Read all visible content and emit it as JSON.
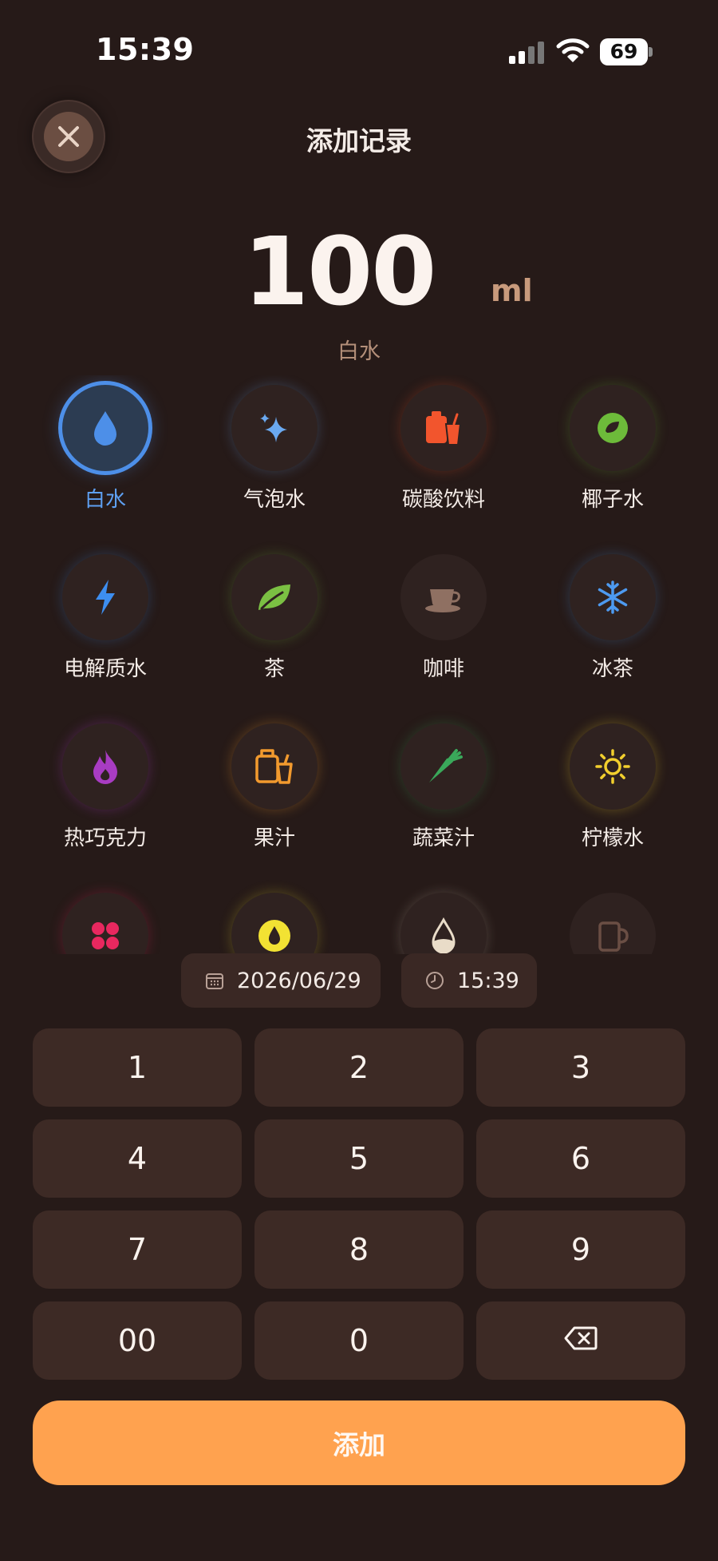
{
  "status_bar": {
    "time": "15:39",
    "battery": "69"
  },
  "header": {
    "title": "添加记录"
  },
  "amount": {
    "value": "100",
    "unit": "ml",
    "drink": "白水"
  },
  "drinks": [
    {
      "label": "白水",
      "icon": "water-drop-icon",
      "color": "#4d8fe8",
      "selected": true
    },
    {
      "label": "气泡水",
      "icon": "sparkles-icon",
      "color": "#6aa9f0"
    },
    {
      "label": "碳酸饮料",
      "icon": "soda-can-icon",
      "color": "#f2552d"
    },
    {
      "label": "椰子水",
      "icon": "coconut-icon",
      "color": "#6dbb3a"
    },
    {
      "label": "电解质水",
      "icon": "lightning-icon",
      "color": "#3d8ef0"
    },
    {
      "label": "茶",
      "icon": "leaf-icon",
      "color": "#7bc043"
    },
    {
      "label": "咖啡",
      "icon": "coffee-cup-icon",
      "color": "#8f7062"
    },
    {
      "label": "冰茶",
      "icon": "snowflake-icon",
      "color": "#4d9af0"
    },
    {
      "label": "热巧克力",
      "icon": "flame-icon",
      "color": "#a83cc2"
    },
    {
      "label": "果汁",
      "icon": "juice-box-icon",
      "color": "#f29a2e"
    },
    {
      "label": "蔬菜汁",
      "icon": "carrot-icon",
      "color": "#3aa85a"
    },
    {
      "label": "柠檬水",
      "icon": "sun-icon",
      "color": "#f2cf2e"
    },
    {
      "label": "",
      "icon": "clover-icon",
      "color": "#e8285f"
    },
    {
      "label": "",
      "icon": "yellow-drop-icon",
      "color": "#f2e233"
    },
    {
      "label": "",
      "icon": "milk-drop-icon",
      "color": "#e9dcc8"
    },
    {
      "label": "",
      "icon": "mug-icon",
      "color": "#6a4e44"
    }
  ],
  "date_chip": {
    "date": "2026/06/29",
    "icon": "calendar-icon"
  },
  "time_chip": {
    "time": "15:39",
    "icon": "clock-icon"
  },
  "keypad": {
    "keys": [
      "1",
      "2",
      "3",
      "4",
      "5",
      "6",
      "7",
      "8",
      "9",
      "00",
      "0"
    ],
    "backspace_icon": "backspace-icon"
  },
  "add_button": {
    "label": "添加"
  },
  "colors": {
    "background": "#261a18",
    "key": "#3d2a25",
    "accent": "#ffa24f",
    "selected": "#4d8fe8"
  }
}
